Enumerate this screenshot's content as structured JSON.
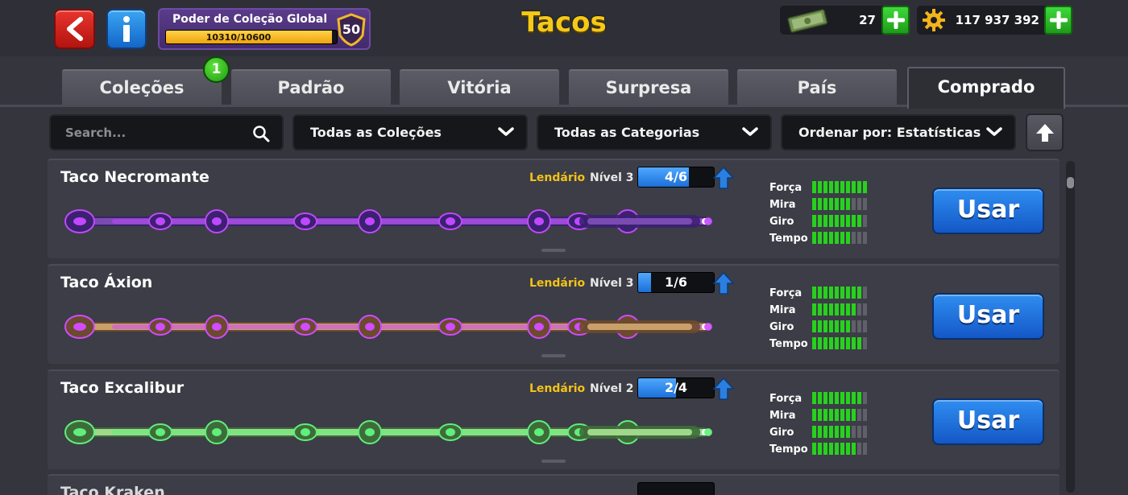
{
  "header": {
    "title": "Tacos",
    "collection_power": {
      "label": "Poder de Coleção Global",
      "progress_text": "10310/10600",
      "progress_fraction": 0.9726,
      "level": "50"
    },
    "currencies": {
      "cash": "27",
      "coins": "117 937 392"
    }
  },
  "tabs": [
    {
      "label": "Coleções",
      "badge": "1"
    },
    {
      "label": "Padrão"
    },
    {
      "label": "Vitória"
    },
    {
      "label": "Surpresa"
    },
    {
      "label": "País"
    },
    {
      "label": "Comprado",
      "active": true
    }
  ],
  "filters": {
    "search_placeholder": "Search...",
    "collection": "Todas as Coleções",
    "category": "Todas as Categorias",
    "sort": "Ordenar por: Estatísticas"
  },
  "stat_labels": {
    "force": "Força",
    "aim": "Mira",
    "spin": "Giro",
    "time": "Tempo"
  },
  "cues": [
    {
      "name": "Taco Necromante",
      "rarity": "Lendário",
      "level": "Nível 3",
      "progress_text": "4/6",
      "progress_fraction": 0.6667,
      "stats": {
        "force": 10,
        "aim": 7,
        "spin": 9,
        "time": 7
      },
      "action": "Usar",
      "accent": "#c048ff"
    },
    {
      "name": "Taco Áxion",
      "rarity": "Lendário",
      "level": "Nível 3",
      "progress_text": "1/6",
      "progress_fraction": 0.1667,
      "stats": {
        "force": 9,
        "aim": 8,
        "spin": 7,
        "time": 9
      },
      "action": "Usar",
      "accent": "#d14bff"
    },
    {
      "name": "Taco Excalibur",
      "rarity": "Lendário",
      "level": "Nível 2",
      "progress_text": "2/4",
      "progress_fraction": 0.5,
      "stats": {
        "force": 9,
        "aim": 8,
        "spin": 7,
        "time": 8
      },
      "action": "Usar",
      "accent": "#5ef07a"
    }
  ],
  "next_card_name": "Taco Kraken",
  "colors": {
    "rarity": "#f2c21a",
    "stat_on": "#27d11e",
    "stat_off": "#5f6068",
    "use_button": "#1e6fdc"
  }
}
